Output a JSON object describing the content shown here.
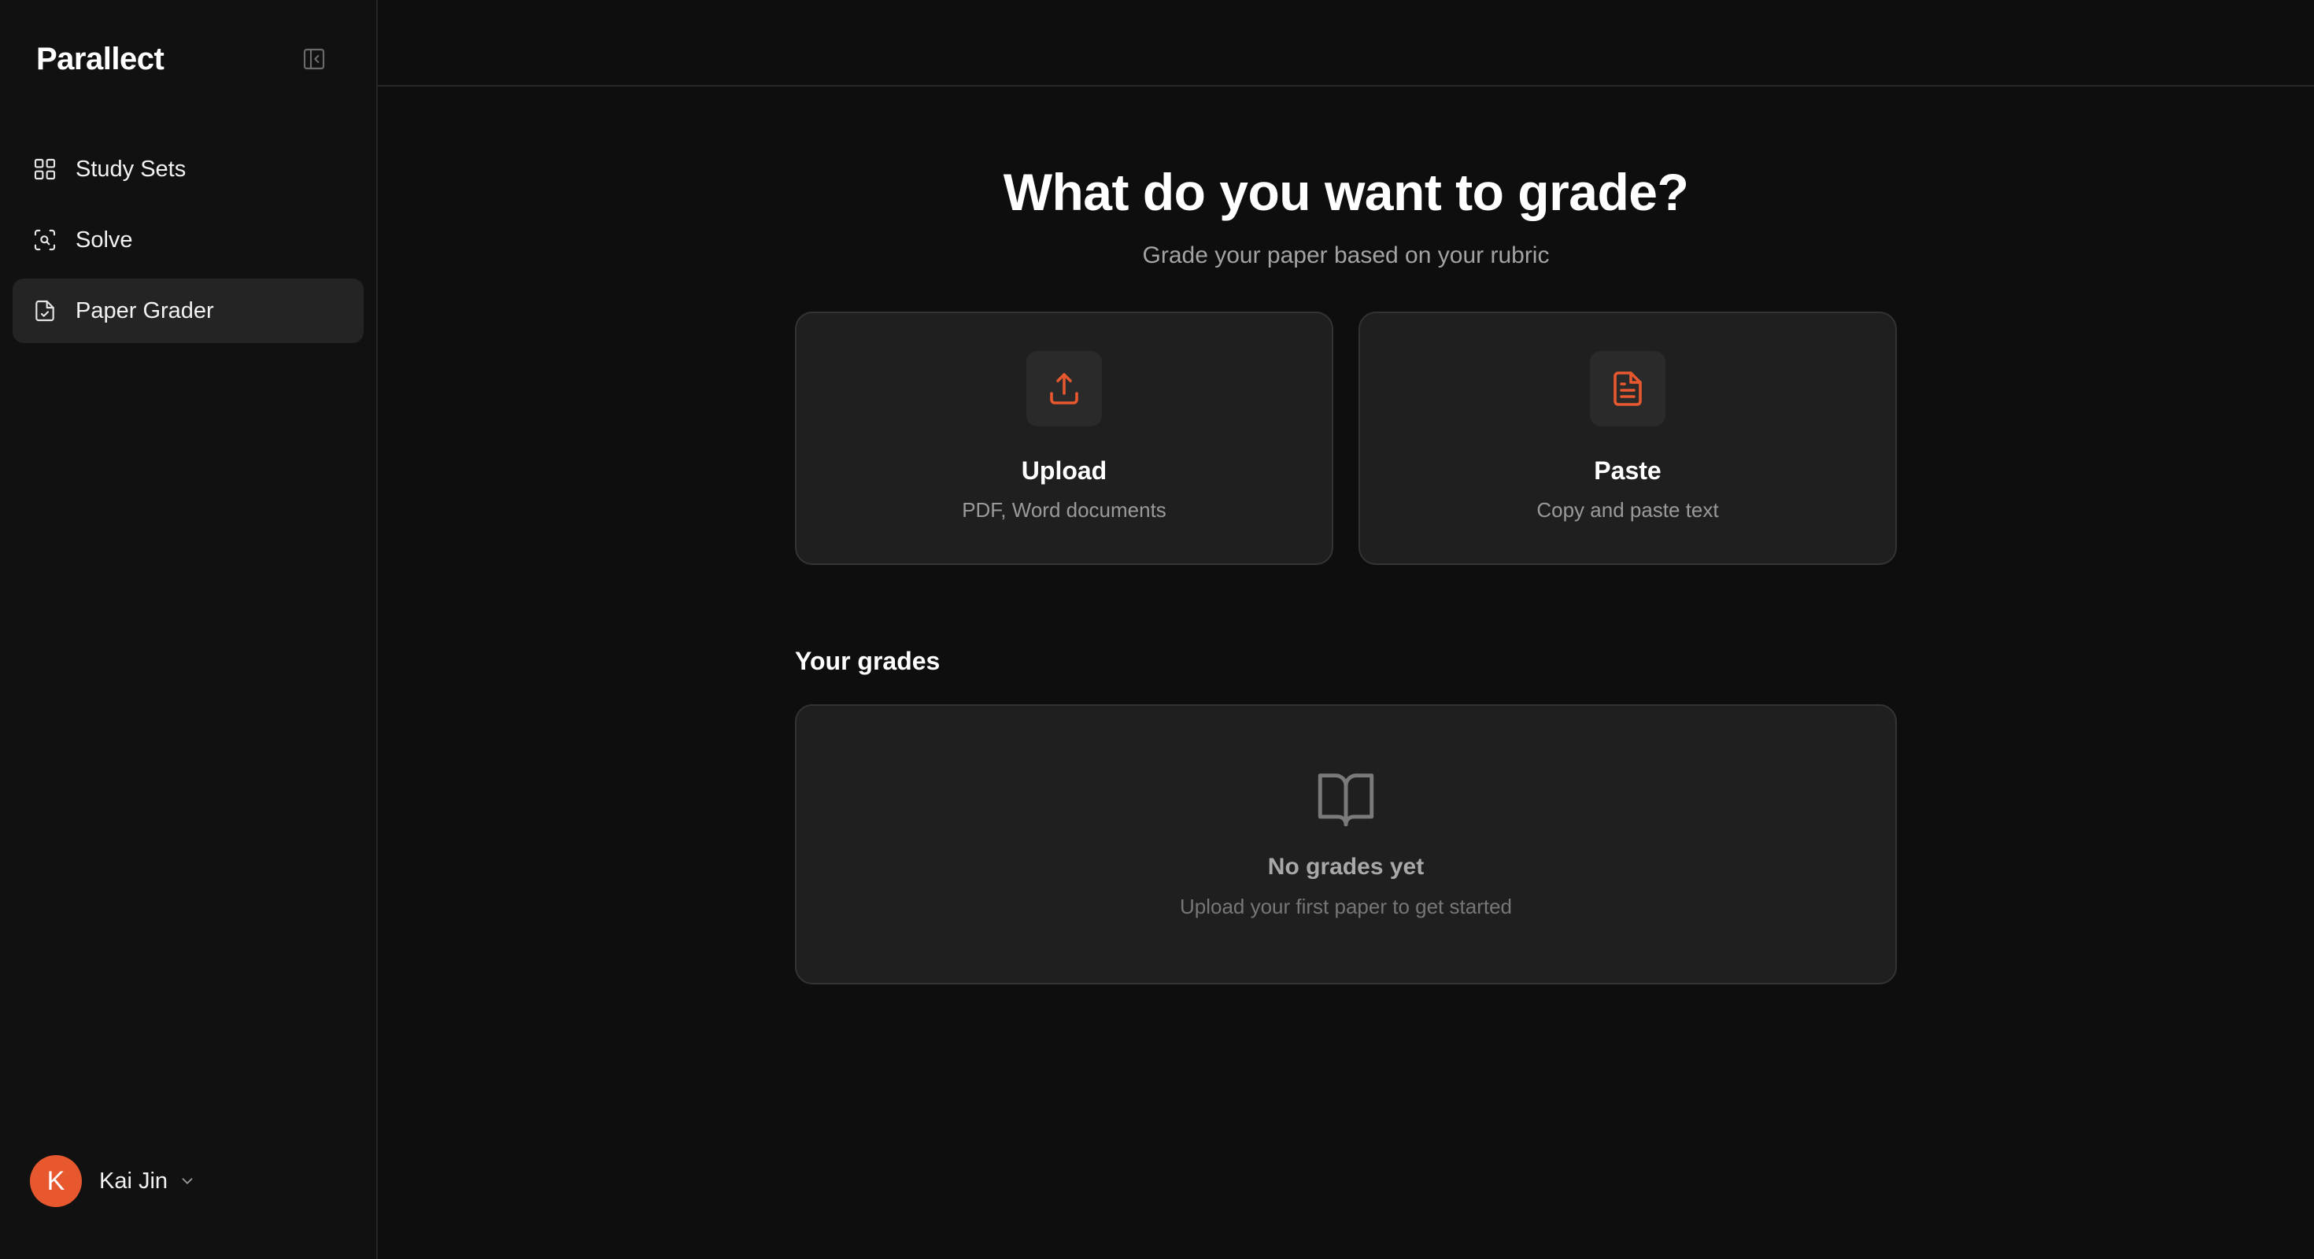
{
  "sidebar": {
    "brand": "Parallect",
    "collapse_icon": "sidebar-collapse-icon",
    "items": [
      {
        "label": "Study Sets",
        "icon": "grid-icon",
        "active": false
      },
      {
        "label": "Solve",
        "icon": "scan-search-icon",
        "active": false
      },
      {
        "label": "Paper Grader",
        "icon": "file-check-icon",
        "active": true
      }
    ],
    "user": {
      "initial": "K",
      "name": "Kai Jin",
      "avatar_color": "#e8582f"
    }
  },
  "main": {
    "title": "What do you want to grade?",
    "subtitle": "Grade your paper based on your rubric",
    "cards": [
      {
        "title": "Upload",
        "subtitle": "PDF, Word documents",
        "icon": "upload-icon"
      },
      {
        "title": "Paste",
        "subtitle": "Copy and paste text",
        "icon": "file-text-icon"
      }
    ],
    "grades": {
      "heading": "Your grades",
      "empty_title": "No grades yet",
      "empty_subtitle": "Upload your first paper to get started",
      "empty_icon": "book-open-icon"
    }
  },
  "colors": {
    "accent": "#e8582f",
    "background": "#0e0e0e",
    "card": "#1f1f1f"
  }
}
